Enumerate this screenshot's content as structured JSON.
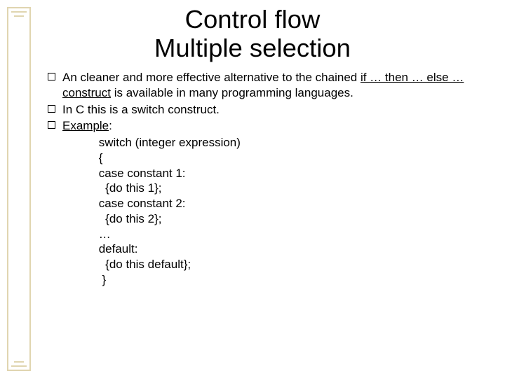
{
  "title_line1": "Control flow",
  "title_line2": "Multiple selection",
  "bullets": {
    "b1_pre": "An cleaner and more effective alternative to the chained ",
    "b1_u1": "if … then … else … construct",
    "b1_post": " is available in many programming languages.",
    "b2": "In C this is a switch construct.",
    "b3_u": "Example",
    "b3_colon": ":"
  },
  "code": {
    "l1": " switch (integer expression)",
    "l2": " {",
    "l3": " case constant 1:",
    "l4": "   {do this 1};",
    "l5": " case constant 2:",
    "l6": "   {do this 2};",
    "l7": " …",
    "l8": " default:",
    "l9": "   {do this default};",
    "l10": "  }"
  }
}
